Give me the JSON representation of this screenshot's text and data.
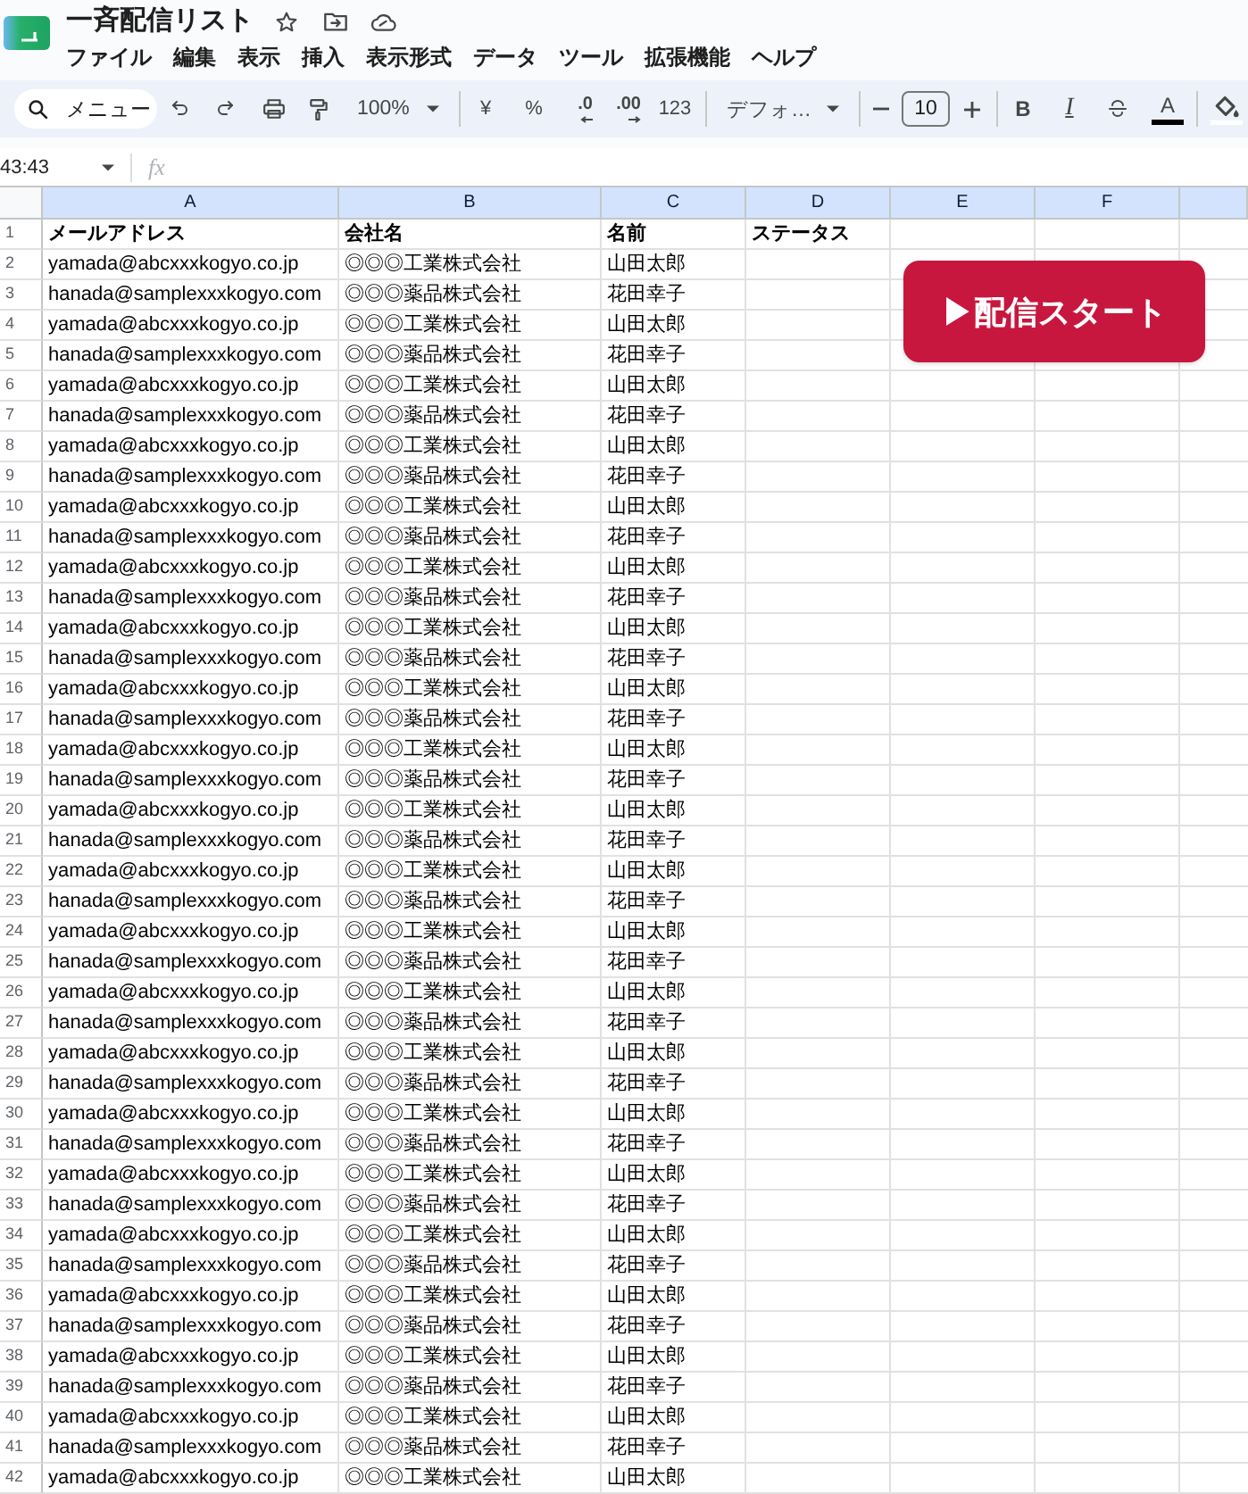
{
  "window": {
    "title": "一斉配信リスト"
  },
  "menu": [
    "ファイル",
    "編集",
    "表示",
    "挿入",
    "表示形式",
    "データ",
    "ツール",
    "拡張機能",
    "ヘルプ"
  ],
  "toolbar": {
    "search": "メニュー",
    "zoom": "100%",
    "currency": "¥",
    "percent": "%",
    "decrease_decimals": ".0",
    "increase_decimals": ".00",
    "number_format": "123",
    "font": "デフォ…",
    "font_size": "10",
    "bold": "B",
    "italic": "I",
    "text_color": "A"
  },
  "formula_bar": {
    "name_box": "43:43",
    "function_label": "fx"
  },
  "sheet": {
    "columns": [
      "A",
      "B",
      "C",
      "D",
      "E",
      "F"
    ],
    "rows": [
      {
        "number": "1",
        "kind": "header",
        "cells": [
          "メールアドレス",
          "会社名",
          "名前",
          "ステータス"
        ]
      },
      {
        "number": "2",
        "kind": "data",
        "cells": [
          "yamada@abcxxxkogyo.co.jp",
          "◎◎◎工業株式会社",
          "山田太郎"
        ]
      },
      {
        "number": "3",
        "kind": "data",
        "cells": [
          "hanada@samplexxxkogyo.com",
          "◎◎◎薬品株式会社",
          "花田幸子"
        ]
      },
      {
        "number": "4",
        "kind": "data",
        "cells": [
          "yamada@abcxxxkogyo.co.jp",
          "◎◎◎工業株式会社",
          "山田太郎"
        ]
      },
      {
        "number": "5",
        "kind": "data",
        "cells": [
          "hanada@samplexxxkogyo.com",
          "◎◎◎薬品株式会社",
          "花田幸子"
        ]
      },
      {
        "number": "6",
        "kind": "data",
        "cells": [
          "yamada@abcxxxkogyo.co.jp",
          "◎◎◎工業株式会社",
          "山田太郎"
        ]
      },
      {
        "number": "7",
        "kind": "data",
        "cells": [
          "hanada@samplexxxkogyo.com",
          "◎◎◎薬品株式会社",
          "花田幸子"
        ]
      },
      {
        "number": "8",
        "kind": "data",
        "cells": [
          "yamada@abcxxxkogyo.co.jp",
          "◎◎◎工業株式会社",
          "山田太郎"
        ]
      },
      {
        "number": "9",
        "kind": "data",
        "cells": [
          "hanada@samplexxxkogyo.com",
          "◎◎◎薬品株式会社",
          "花田幸子"
        ]
      },
      {
        "number": "10",
        "kind": "data",
        "cells": [
          "yamada@abcxxxkogyo.co.jp",
          "◎◎◎工業株式会社",
          "山田太郎"
        ]
      },
      {
        "number": "11",
        "kind": "data",
        "cells": [
          "hanada@samplexxxkogyo.com",
          "◎◎◎薬品株式会社",
          "花田幸子"
        ]
      },
      {
        "number": "12",
        "kind": "data",
        "cells": [
          "yamada@abcxxxkogyo.co.jp",
          "◎◎◎工業株式会社",
          "山田太郎"
        ]
      },
      {
        "number": "13",
        "kind": "data",
        "cells": [
          "hanada@samplexxxkogyo.com",
          "◎◎◎薬品株式会社",
          "花田幸子"
        ]
      },
      {
        "number": "14",
        "kind": "data",
        "cells": [
          "yamada@abcxxxkogyo.co.jp",
          "◎◎◎工業株式会社",
          "山田太郎"
        ]
      },
      {
        "number": "15",
        "kind": "data",
        "cells": [
          "hanada@samplexxxkogyo.com",
          "◎◎◎薬品株式会社",
          "花田幸子"
        ]
      },
      {
        "number": "16",
        "kind": "data",
        "cells": [
          "yamada@abcxxxkogyo.co.jp",
          "◎◎◎工業株式会社",
          "山田太郎"
        ]
      },
      {
        "number": "17",
        "kind": "data",
        "cells": [
          "hanada@samplexxxkogyo.com",
          "◎◎◎薬品株式会社",
          "花田幸子"
        ]
      },
      {
        "number": "18",
        "kind": "data",
        "cells": [
          "yamada@abcxxxkogyo.co.jp",
          "◎◎◎工業株式会社",
          "山田太郎"
        ]
      },
      {
        "number": "19",
        "kind": "data",
        "cells": [
          "hanada@samplexxxkogyo.com",
          "◎◎◎薬品株式会社",
          "花田幸子"
        ]
      },
      {
        "number": "20",
        "kind": "data",
        "cells": [
          "yamada@abcxxxkogyo.co.jp",
          "◎◎◎工業株式会社",
          "山田太郎"
        ]
      },
      {
        "number": "21",
        "kind": "data",
        "cells": [
          "hanada@samplexxxkogyo.com",
          "◎◎◎薬品株式会社",
          "花田幸子"
        ]
      },
      {
        "number": "22",
        "kind": "data",
        "cells": [
          "yamada@abcxxxkogyo.co.jp",
          "◎◎◎工業株式会社",
          "山田太郎"
        ]
      },
      {
        "number": "23",
        "kind": "data",
        "cells": [
          "hanada@samplexxxkogyo.com",
          "◎◎◎薬品株式会社",
          "花田幸子"
        ]
      },
      {
        "number": "24",
        "kind": "data",
        "cells": [
          "yamada@abcxxxkogyo.co.jp",
          "◎◎◎工業株式会社",
          "山田太郎"
        ]
      },
      {
        "number": "25",
        "kind": "data",
        "cells": [
          "hanada@samplexxxkogyo.com",
          "◎◎◎薬品株式会社",
          "花田幸子"
        ]
      },
      {
        "number": "26",
        "kind": "data",
        "cells": [
          "yamada@abcxxxkogyo.co.jp",
          "◎◎◎工業株式会社",
          "山田太郎"
        ]
      },
      {
        "number": "27",
        "kind": "data",
        "cells": [
          "hanada@samplexxxkogyo.com",
          "◎◎◎薬品株式会社",
          "花田幸子"
        ]
      },
      {
        "number": "28",
        "kind": "data",
        "cells": [
          "yamada@abcxxxkogyo.co.jp",
          "◎◎◎工業株式会社",
          "山田太郎"
        ]
      },
      {
        "number": "29",
        "kind": "data",
        "cells": [
          "hanada@samplexxxkogyo.com",
          "◎◎◎薬品株式会社",
          "花田幸子"
        ]
      },
      {
        "number": "30",
        "kind": "data",
        "cells": [
          "yamada@abcxxxkogyo.co.jp",
          "◎◎◎工業株式会社",
          "山田太郎"
        ]
      },
      {
        "number": "31",
        "kind": "data",
        "cells": [
          "hanada@samplexxxkogyo.com",
          "◎◎◎薬品株式会社",
          "花田幸子"
        ]
      },
      {
        "number": "32",
        "kind": "data",
        "cells": [
          "yamada@abcxxxkogyo.co.jp",
          "◎◎◎工業株式会社",
          "山田太郎"
        ]
      },
      {
        "number": "33",
        "kind": "data",
        "cells": [
          "hanada@samplexxxkogyo.com",
          "◎◎◎薬品株式会社",
          "花田幸子"
        ]
      },
      {
        "number": "34",
        "kind": "data",
        "cells": [
          "yamada@abcxxxkogyo.co.jp",
          "◎◎◎工業株式会社",
          "山田太郎"
        ]
      },
      {
        "number": "35",
        "kind": "data",
        "cells": [
          "hanada@samplexxxkogyo.com",
          "◎◎◎薬品株式会社",
          "花田幸子"
        ]
      },
      {
        "number": "36",
        "kind": "data",
        "cells": [
          "yamada@abcxxxkogyo.co.jp",
          "◎◎◎工業株式会社",
          "山田太郎"
        ]
      },
      {
        "number": "37",
        "kind": "data",
        "cells": [
          "hanada@samplexxxkogyo.com",
          "◎◎◎薬品株式会社",
          "花田幸子"
        ]
      },
      {
        "number": "38",
        "kind": "data",
        "cells": [
          "yamada@abcxxxkogyo.co.jp",
          "◎◎◎工業株式会社",
          "山田太郎"
        ]
      },
      {
        "number": "39",
        "kind": "data",
        "cells": [
          "hanada@samplexxxkogyo.com",
          "◎◎◎薬品株式会社",
          "花田幸子"
        ]
      },
      {
        "number": "40",
        "kind": "data",
        "cells": [
          "yamada@abcxxxkogyo.co.jp",
          "◎◎◎工業株式会社",
          "山田太郎"
        ]
      },
      {
        "number": "41",
        "kind": "data",
        "cells": [
          "hanada@samplexxxkogyo.com",
          "◎◎◎薬品株式会社",
          "花田幸子"
        ]
      },
      {
        "number": "42",
        "kind": "data",
        "cells": [
          "yamada@abcxxxkogyo.co.jp",
          "◎◎◎工業株式会社",
          "山田太郎"
        ]
      }
    ]
  },
  "action_button": {
    "label": "▶配信スタート"
  }
}
